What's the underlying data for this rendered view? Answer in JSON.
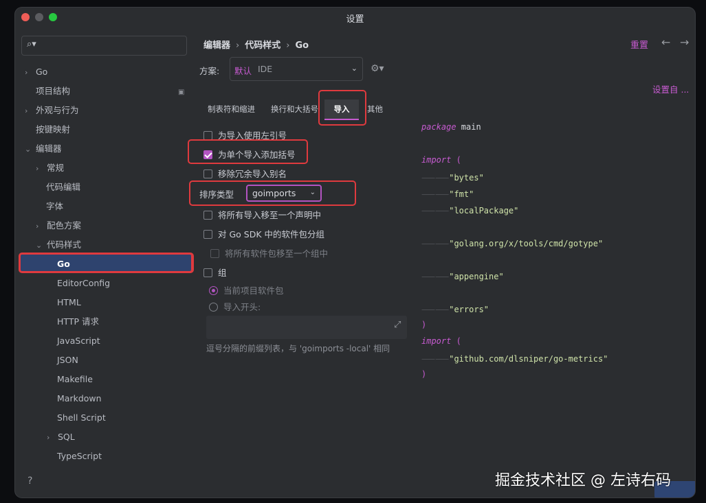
{
  "window": {
    "title": "设置"
  },
  "sidebar": {
    "search_placeholder": "",
    "items": [
      {
        "label": "Go",
        "chev": "›"
      },
      {
        "label": "项目结构",
        "chev": ""
      },
      {
        "label": "外观与行为",
        "chev": "›"
      },
      {
        "label": "按键映射",
        "chev": ""
      },
      {
        "label": "编辑器",
        "chev": "⌄"
      },
      {
        "label": "常规",
        "chev": "›"
      },
      {
        "label": "代码编辑",
        "chev": ""
      },
      {
        "label": "字体",
        "chev": ""
      },
      {
        "label": "配色方案",
        "chev": "›"
      },
      {
        "label": "代码样式",
        "chev": "⌄"
      },
      {
        "label": "Go",
        "chev": ""
      },
      {
        "label": "EditorConfig",
        "chev": ""
      },
      {
        "label": "HTML",
        "chev": ""
      },
      {
        "label": "HTTP 请求",
        "chev": ""
      },
      {
        "label": "JavaScript",
        "chev": ""
      },
      {
        "label": "JSON",
        "chev": ""
      },
      {
        "label": "Makefile",
        "chev": ""
      },
      {
        "label": "Markdown",
        "chev": ""
      },
      {
        "label": "Shell Script",
        "chev": ""
      },
      {
        "label": "SQL",
        "chev": "›"
      },
      {
        "label": "TypeScript",
        "chev": ""
      }
    ],
    "help": "?"
  },
  "header": {
    "crumb1": "编辑器",
    "crumb2": "代码样式",
    "crumb3": "Go",
    "sep": "›",
    "reset": "重置",
    "back": "←",
    "forward": "→"
  },
  "scheme": {
    "label": "方案:",
    "value_name": "默认",
    "value_scope": "IDE",
    "settings_link": "设置自 ..."
  },
  "tabs": [
    "制表符和缩进",
    "换行和大括号",
    "导入",
    "其他"
  ],
  "options": {
    "use_backquote": "为导入使用左引号",
    "add_parens": "为单个导入添加括号",
    "remove_alias": "移除冗余导入别名",
    "sort_label": "排序类型",
    "sort_value": "goimports",
    "move_all": "将所有导入移至一个声明中",
    "group_sdk": "对 Go SDK 中的软件包分组",
    "move_to_one_group": "将所有软件包移至一个组中",
    "group": "组",
    "radio_current": "当前项目软件包",
    "radio_prefix": "导入开头:",
    "hint": "逗号分隔的前缀列表，与 'goimports -local' 相同"
  },
  "code": {
    "package_kw": "package",
    "package_name": " main",
    "import_kw": "import",
    "paren_open": " (",
    "paren_close": ")",
    "guide": "⸺⸺",
    "imports1": [
      "\"bytes\"",
      "\"fmt\"",
      "\"localPackage\""
    ],
    "import_gotype": "\"golang.org/x/tools/cmd/gotype\"",
    "import_appengine": "\"appengine\"",
    "import_errors": "\"errors\"",
    "import_metrics": "\"github.com/dlsniper/go-metrics\""
  },
  "watermark": "掘金技术社区 @ 左诗右码",
  "colors": {
    "accent": "#c75bd1",
    "highlight": "#e03a3e",
    "selection": "#2e436e"
  }
}
